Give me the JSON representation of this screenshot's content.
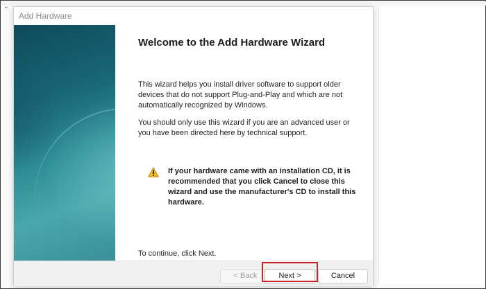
{
  "window": {
    "title": "Add Hardware"
  },
  "wizard": {
    "heading": "Welcome to the Add Hardware Wizard",
    "paragraph_1": "This wizard helps you install driver software to support older devices that do not support Plug-and-Play and which are not automatically recognized by Windows.",
    "paragraph_2": "You should only use this wizard if you are an advanced user or you have been directed here by technical support.",
    "warning_icon": "warning-triangle-icon",
    "warning_text": "If your hardware came with an installation CD, it is recommended that you click Cancel to close this wizard and use the manufacturer's CD to install this hardware.",
    "continue_text": "To continue, click Next."
  },
  "buttons": {
    "back_label": "< Back",
    "next_label": "Next >",
    "cancel_label": "Cancel"
  },
  "colors": {
    "highlight": "#c8262c",
    "warning": "#e8a317",
    "panel_teal": "#176575"
  }
}
